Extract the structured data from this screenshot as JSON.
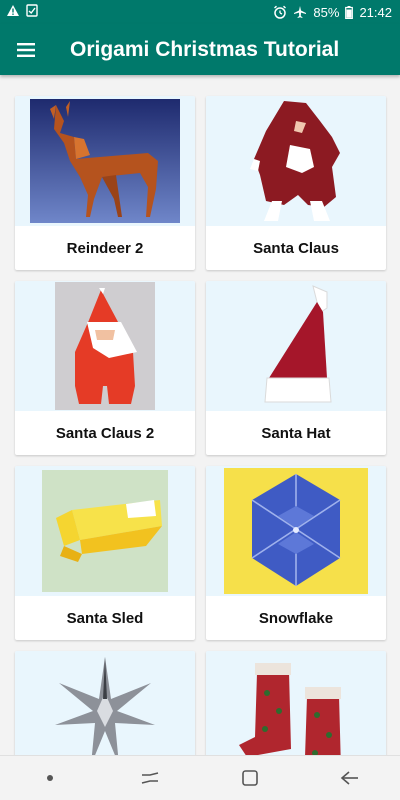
{
  "status_bar": {
    "battery": "85%",
    "time": "21:42",
    "icons": [
      "warning-icon",
      "checkbox-icon",
      "alarm-icon",
      "airplane-icon",
      "battery-icon"
    ]
  },
  "app_bar": {
    "title": "Origami Christmas Tutorial",
    "menu_icon": "hamburger-menu-icon"
  },
  "grid": {
    "items": [
      {
        "label": "Reindeer 2",
        "image": "reindeer-image"
      },
      {
        "label": "Santa Claus",
        "image": "santa-claus-image"
      },
      {
        "label": "Santa Claus 2",
        "image": "santa-claus-2-image"
      },
      {
        "label": "Santa Hat",
        "image": "santa-hat-image"
      },
      {
        "label": "Santa Sled",
        "image": "santa-sled-image"
      },
      {
        "label": "Snowflake",
        "image": "snowflake-image"
      },
      {
        "label": "",
        "image": "star-image"
      },
      {
        "label": "",
        "image": "stocking-image"
      }
    ]
  },
  "nav_bar": {
    "buttons": [
      "dot-icon",
      "recents-icon",
      "home-icon",
      "back-icon"
    ]
  },
  "colors": {
    "primary": "#00796b",
    "card_image_bg": "#e9f6fd"
  }
}
